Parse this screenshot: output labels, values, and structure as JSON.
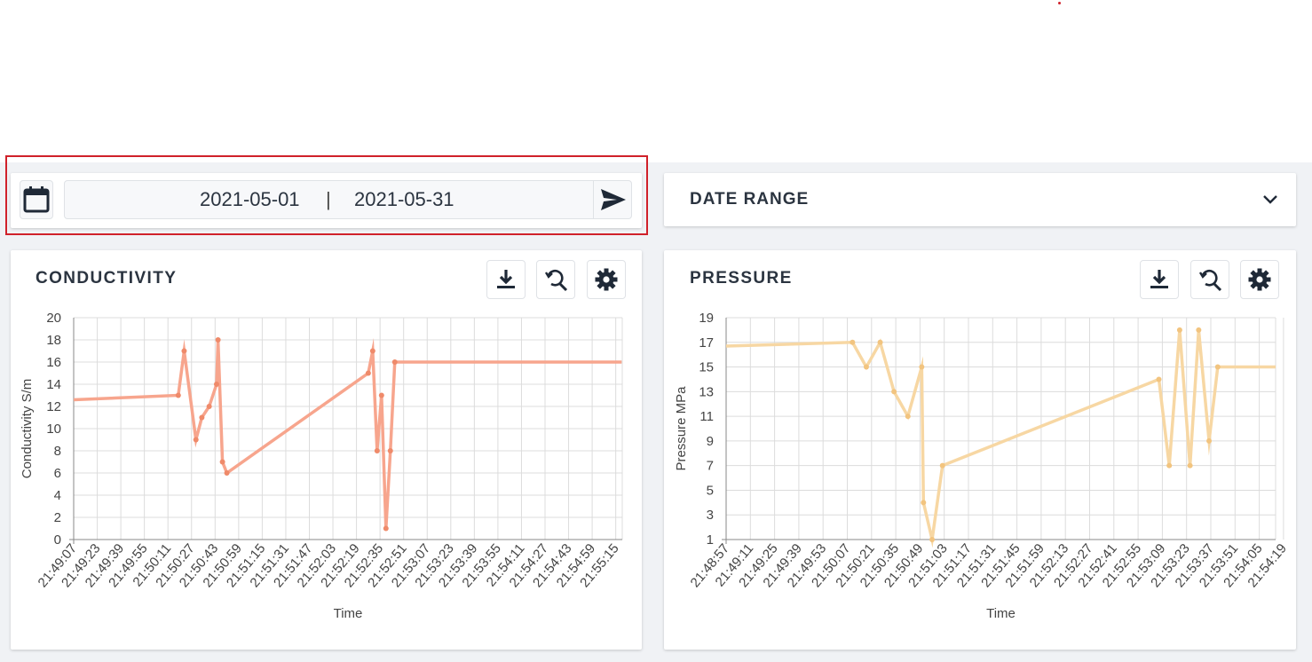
{
  "date_picker": {
    "start": "2021-05-01",
    "separator": "|",
    "end": "2021-05-31"
  },
  "range_select": {
    "label": "DATE RANGE"
  },
  "icons": {
    "calendar": "calendar-icon",
    "send": "send-icon",
    "chevron": "chevron-down-icon",
    "download": "download-icon",
    "zoom_reset": "zoom-reset-icon",
    "settings": "gear-icon"
  },
  "colors": {
    "conductivity": "#f7a58d",
    "conductivity_point": "#ef8a6a",
    "pressure": "#f7d7a3",
    "pressure_point": "#f2c47f",
    "highlight": "#d0212a"
  },
  "conductivity_card": {
    "title": "CONDUCTIVITY"
  },
  "pressure_card": {
    "title": "PRESSURE"
  },
  "chart_data": [
    {
      "type": "line",
      "title": "CONDUCTIVITY",
      "xlabel": "Time",
      "ylabel": "Conductivity S/m",
      "ylim": [
        0,
        20
      ],
      "yticks": [
        0,
        2,
        4,
        6,
        8,
        10,
        12,
        14,
        16,
        18,
        20
      ],
      "xticks": [
        "21:49:07",
        "21:49:23",
        "21:49:39",
        "21:49:55",
        "21:50:11",
        "21:50:27",
        "21:50:43",
        "21:50:59",
        "21:51:15",
        "21:51:31",
        "21:51:47",
        "21:52:03",
        "21:52:19",
        "21:52:35",
        "21:52:51",
        "21:53:07",
        "21:53:23",
        "21:53:39",
        "21:53:55",
        "21:54:11",
        "21:54:27",
        "21:54:43",
        "21:54:59",
        "21:55:15"
      ],
      "grid": true,
      "series": [
        {
          "values": [
            {
              "x": "21:49:07",
              "y": 12.6
            },
            {
              "x": "21:50:18",
              "y": 13
            },
            {
              "x": "21:50:22",
              "y": 17
            },
            {
              "x": "21:50:30",
              "y": 9
            },
            {
              "x": "21:50:34",
              "y": 11
            },
            {
              "x": "21:50:39",
              "y": 12
            },
            {
              "x": "21:50:44",
              "y": 14
            },
            {
              "x": "21:50:45",
              "y": 18
            },
            {
              "x": "21:50:48",
              "y": 7
            },
            {
              "x": "21:50:51",
              "y": 6
            },
            {
              "x": "21:52:27",
              "y": 15
            },
            {
              "x": "21:52:30",
              "y": 17
            },
            {
              "x": "21:52:33",
              "y": 8
            },
            {
              "x": "21:52:36",
              "y": 13
            },
            {
              "x": "21:52:39",
              "y": 1
            },
            {
              "x": "21:52:42",
              "y": 8
            },
            {
              "x": "21:52:45",
              "y": 16
            },
            {
              "x": "21:55:19",
              "y": 16
            }
          ]
        }
      ]
    },
    {
      "type": "line",
      "title": "PRESSURE",
      "xlabel": "Time",
      "ylabel": "Pressure MPa",
      "ylim": [
        1,
        19
      ],
      "yticks": [
        1,
        3,
        5,
        7,
        9,
        11,
        13,
        15,
        17,
        19
      ],
      "xticks": [
        "21:48:57",
        "21:49:11",
        "21:49:25",
        "21:49:39",
        "21:49:53",
        "21:50:07",
        "21:50:21",
        "21:50:35",
        "21:50:49",
        "21:51:03",
        "21:51:17",
        "21:51:31",
        "21:51:45",
        "21:51:59",
        "21:52:13",
        "21:52:27",
        "21:52:41",
        "21:52:55",
        "21:53:09",
        "21:53:23",
        "21:53:37",
        "21:53:51",
        "21:54:05",
        "21:54:19"
      ],
      "grid": true,
      "series": [
        {
          "values": [
            {
              "x": "21:48:57",
              "y": 16.7
            },
            {
              "x": "21:50:10",
              "y": 17
            },
            {
              "x": "21:50:18",
              "y": 15
            },
            {
              "x": "21:50:26",
              "y": 17
            },
            {
              "x": "21:50:34",
              "y": 13
            },
            {
              "x": "21:50:42",
              "y": 11
            },
            {
              "x": "21:50:50",
              "y": 15
            },
            {
              "x": "21:50:51",
              "y": 4
            },
            {
              "x": "21:50:56",
              "y": 1
            },
            {
              "x": "21:51:02",
              "y": 7
            },
            {
              "x": "21:53:07",
              "y": 14
            },
            {
              "x": "21:53:13",
              "y": 7
            },
            {
              "x": "21:53:19",
              "y": 18
            },
            {
              "x": "21:53:25",
              "y": 7
            },
            {
              "x": "21:53:30",
              "y": 18
            },
            {
              "x": "21:53:36",
              "y": 9
            },
            {
              "x": "21:53:41",
              "y": 15
            },
            {
              "x": "21:54:29",
              "y": 15
            }
          ]
        }
      ]
    }
  ]
}
